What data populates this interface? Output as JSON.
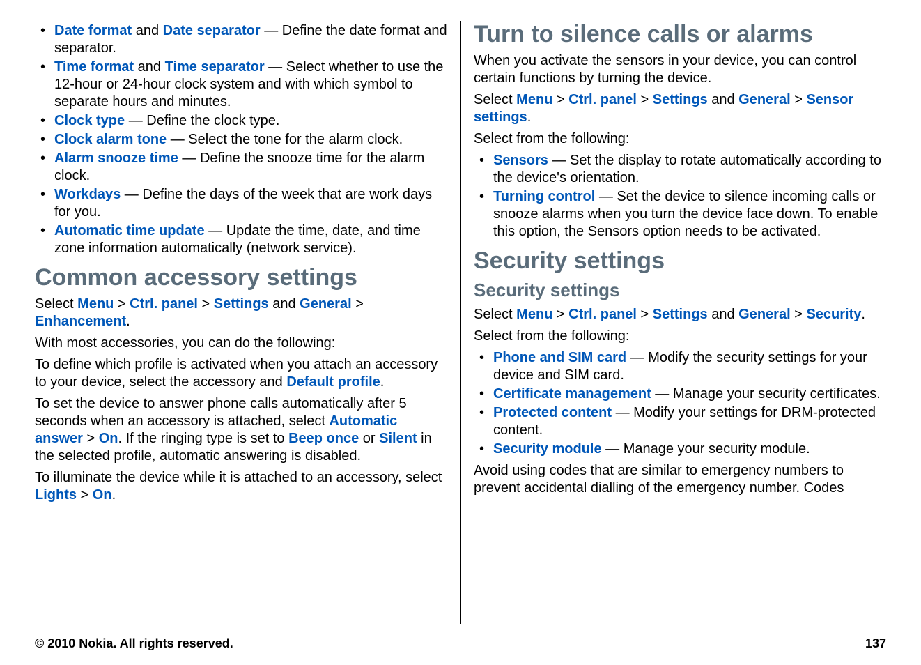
{
  "left": {
    "bullets1": [
      {
        "opt1": "Date format",
        "opt2": "Date separator",
        "desc": " — Define the date format and separator."
      },
      {
        "opt1": "Time format",
        "opt2": "Time separator",
        "desc": " — Select whether to use the 12-hour or 24-hour clock system and with which symbol to separate hours and minutes."
      },
      {
        "opt1": "Clock type",
        "desc": "  — Define the clock type."
      },
      {
        "opt1": "Clock alarm tone",
        "desc": "  — Select the tone for the alarm clock."
      },
      {
        "opt1": "Alarm snooze time",
        "desc": "  — Define the snooze time for the alarm clock."
      },
      {
        "opt1": "Workdays",
        "desc": "  — Define the days of the week that are work days for you."
      },
      {
        "opt1": "Automatic time update",
        "desc": "  — Update the time, date, and time zone information automatically (network service)."
      }
    ],
    "h1a": "Common accessory settings",
    "nav1": {
      "prefix": "Select ",
      "menu": "Menu",
      "ctrl": "Ctrl. panel",
      "settings": "Settings",
      "and": " and ",
      "general": "General",
      "dest": "Enhancement"
    },
    "p1": "With most accessories, you can do the following:",
    "p2a": "To define which profile is activated when you attach an accessory to your device, select the accessory and ",
    "p2opt": "Default profile",
    "p3a": "To set the device to answer phone calls automatically after 5 seconds when an accessory is attached, select ",
    "p3opt1": "Automatic answer",
    "p3opt2": "On",
    "p3b": ". If the ringing type is set to ",
    "p3opt3": "Beep once",
    "p3c": " or ",
    "p3opt4": "Silent",
    "p3d": " in the selected profile, automatic answering is disabled.",
    "p4a": "To illuminate the device while it is attached to an accessory, select ",
    "p4opt1": "Lights",
    "p4opt2": "On"
  },
  "right": {
    "h1a": "Turn to silence calls or alarms",
    "p1": "When you activate the sensors in your device, you can control certain functions by turning the device.",
    "nav1": {
      "prefix": "Select ",
      "menu": "Menu",
      "ctrl": "Ctrl. panel",
      "settings": "Settings",
      "and": " and ",
      "general": "General",
      "dest": "Sensor settings"
    },
    "p2": "Select from the following:",
    "bullets1": [
      {
        "opt": "Sensors",
        "desc": "  — Set the display to rotate automatically according to the device's orientation."
      },
      {
        "opt": "Turning control",
        "desc": "  — Set the device to silence incoming calls or snooze alarms when you turn the device face down. To enable this option, the Sensors option needs to be activated."
      }
    ],
    "h1b": "Security settings",
    "h2a": "Security settings",
    "nav2": {
      "prefix": "Select ",
      "menu": "Menu",
      "ctrl": "Ctrl. panel",
      "settings": "Settings",
      "and": " and ",
      "general": "General",
      "dest": "Security"
    },
    "p3": "Select from the following:",
    "bullets2": [
      {
        "opt": "Phone and SIM card",
        "desc": "  — Modify the security settings for your device and SIM card."
      },
      {
        "opt": "Certificate management",
        "desc": "  — Manage your security certificates."
      },
      {
        "opt": "Protected content",
        "desc": "  — Modify your settings for DRM-protected content."
      },
      {
        "opt": "Security module",
        "desc": "  — Manage your security module."
      }
    ],
    "p4": "Avoid using codes that are similar to emergency numbers to prevent accidental dialling of the emergency number. Codes"
  },
  "footer": {
    "copyright": "© 2010 Nokia. All rights reserved.",
    "page": "137"
  },
  "sep": " > "
}
